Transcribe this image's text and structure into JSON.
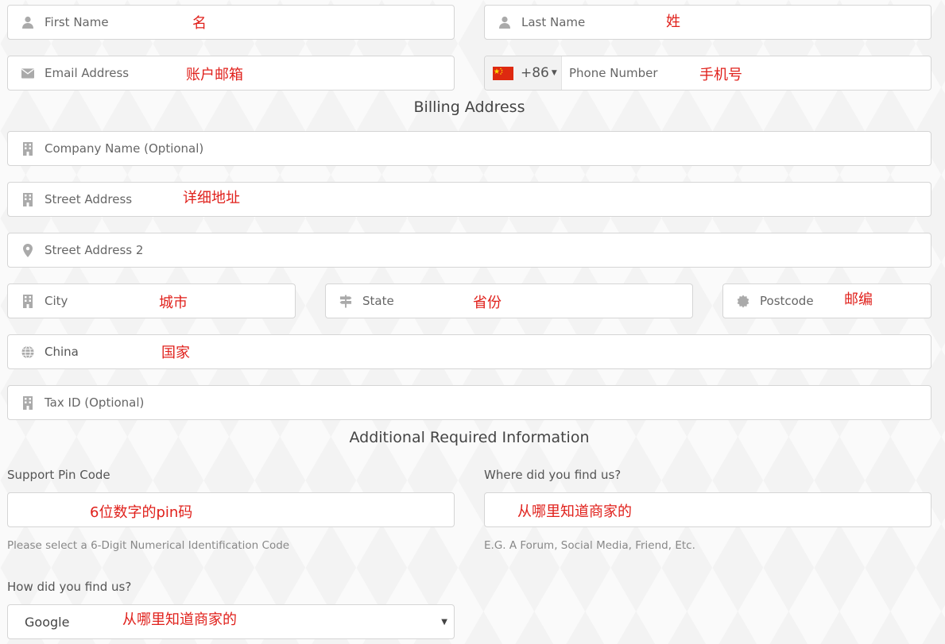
{
  "personal": {
    "first_name": {
      "placeholder": "First Name",
      "note": "名"
    },
    "last_name": {
      "placeholder": "Last Name",
      "note": "姓"
    },
    "email": {
      "placeholder": "Email Address",
      "note": "账户邮箱"
    },
    "phone": {
      "dial_code": "+86",
      "placeholder": "Phone Number",
      "note": "手机号"
    }
  },
  "billing": {
    "title": "Billing Address",
    "company": {
      "placeholder": "Company Name (Optional)"
    },
    "street": {
      "placeholder": "Street Address",
      "note": "详细地址"
    },
    "street2": {
      "placeholder": "Street Address 2"
    },
    "city": {
      "placeholder": "City",
      "note": "城市"
    },
    "state": {
      "placeholder": "State",
      "note": "省份"
    },
    "postcode": {
      "placeholder": "Postcode",
      "note": "邮编"
    },
    "country": {
      "value": "China",
      "note": "国家"
    },
    "tax_id": {
      "placeholder": "Tax ID (Optional)"
    }
  },
  "additional": {
    "title": "Additional Required Information",
    "pin": {
      "label": "Support Pin Code",
      "note": "6位数字的pin码",
      "hint": "Please select a 6-Digit Numerical Identification Code"
    },
    "where": {
      "label": "Where did you find us?",
      "note": "从哪里知道商家的",
      "hint": "E.G. A Forum, Social Media, Friend, Etc."
    },
    "how": {
      "label": "How did you find us?",
      "selected": "Google",
      "note": "从哪里知道商家的"
    }
  },
  "colors": {
    "annotation": "#e0201b",
    "icon": "#aaaaaa",
    "flag_red": "#de2910",
    "flag_star": "#ffde00"
  }
}
